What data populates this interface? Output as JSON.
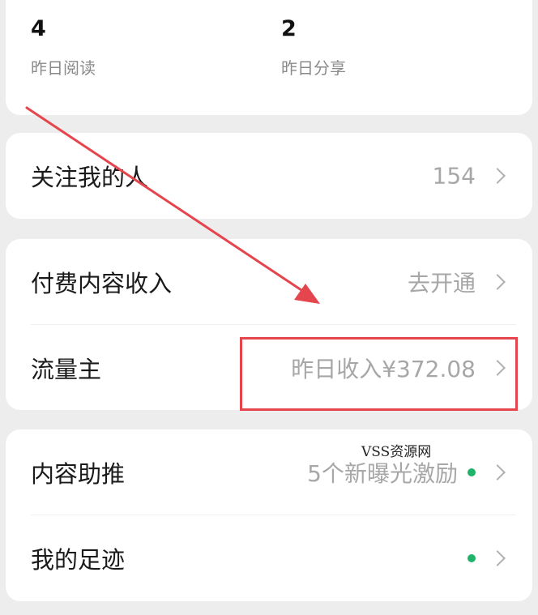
{
  "stats": [
    {
      "value": "4",
      "label": "昨日阅读"
    },
    {
      "value": "2",
      "label": "昨日分享"
    }
  ],
  "followers": {
    "label": "关注我的人",
    "value": "154"
  },
  "paid_content": {
    "label": "付费内容收入",
    "value": "去开通"
  },
  "traffic_owner": {
    "label": "流量主",
    "value": "昨日收入¥372.08"
  },
  "content_boost": {
    "label": "内容助推",
    "value": "5个新曝光激励"
  },
  "my_footprint": {
    "label": "我的足迹"
  },
  "watermark": "VSS资源网",
  "colors": {
    "background": "#ededed",
    "card": "#ffffff",
    "annotation_red": "#e5454d",
    "status_dot": "#1fb36a",
    "muted_text": "#a7a7a7"
  },
  "icons": [
    "chevron-right-icon",
    "green-dot-icon",
    "annotation-arrow"
  ]
}
